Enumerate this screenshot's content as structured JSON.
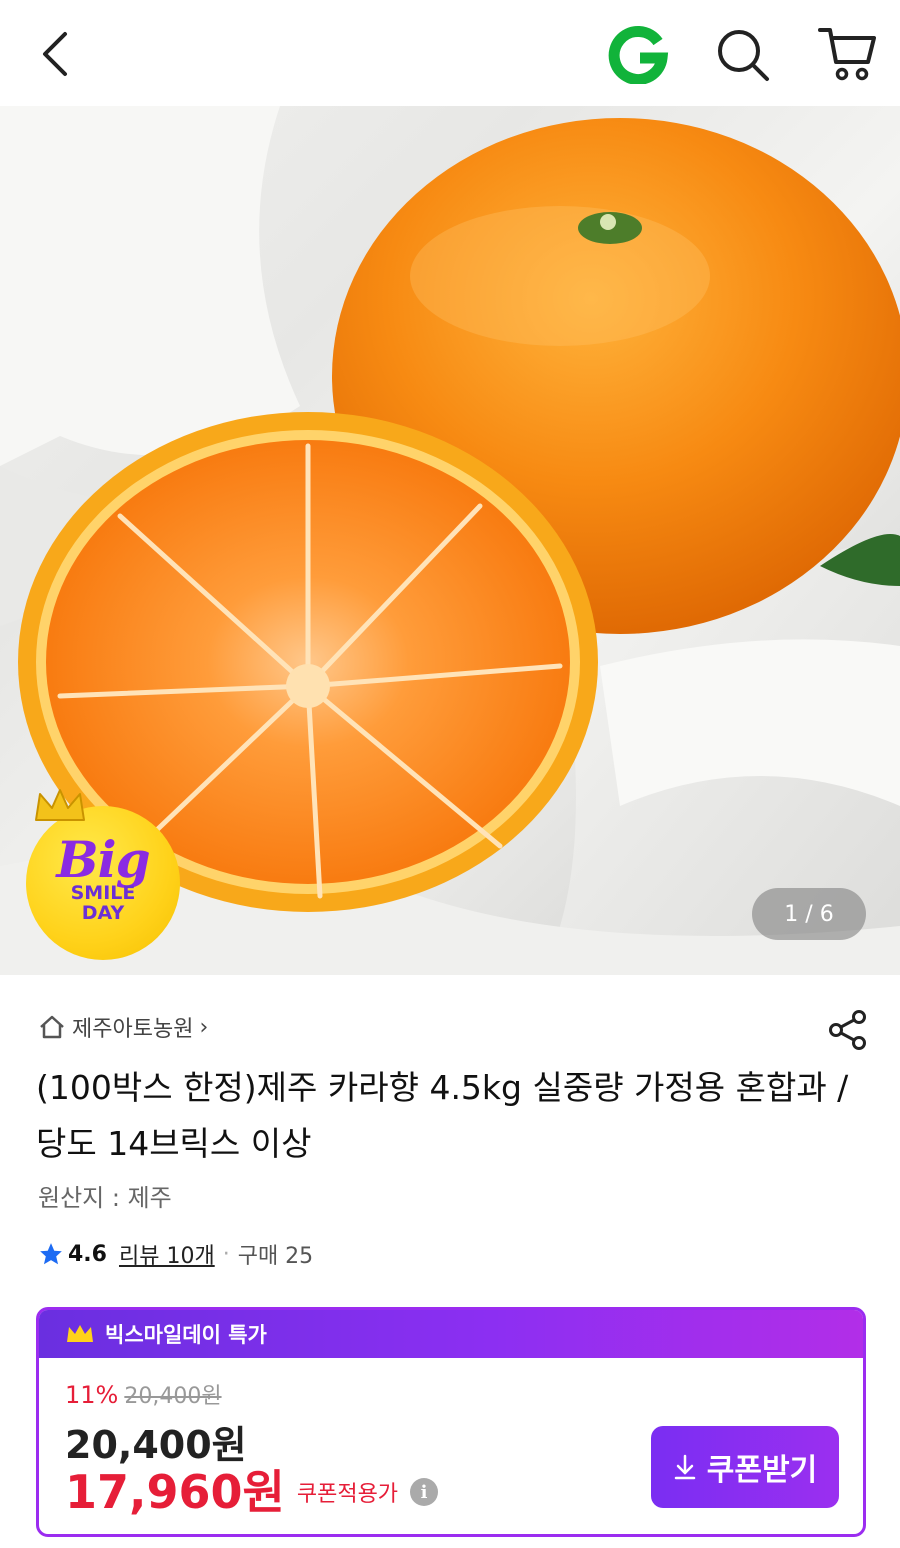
{
  "hero": {
    "counter": "1 / 6",
    "badge": {
      "big": "Big",
      "smile": "SMILE",
      "day": "DAY"
    }
  },
  "product": {
    "seller": "제주아토농원",
    "seller_chevron": "›",
    "title": "(100박스 한정)제주 카라향 4.5kg 실중량 가정용 혼합과 / 당도 14브릭스 이상",
    "origin": "원산지 : 제주",
    "rating": "4.6",
    "reviews": "리뷰 10개",
    "separator": "·",
    "purchases": "구매 25"
  },
  "deal": {
    "header": "빅스마일데이 특가",
    "discount_pct": "11%",
    "original_price": "20,400원",
    "price": "20,400원",
    "coupon_price": "17,960원",
    "coupon_label": "쿠폰적용가",
    "info_icon_glyph": "i",
    "coupon_button": "쿠폰받기"
  },
  "colors": {
    "accent_purple": "#8c2ff2",
    "sale_red": "#e61e38",
    "logo_green": "#11b33a"
  },
  "icons": [
    "back-arrow-icon",
    "g-logo-icon",
    "search-icon",
    "cart-icon",
    "home-icon",
    "share-icon",
    "star-icon",
    "crown-icon",
    "info-icon",
    "download-icon"
  ]
}
